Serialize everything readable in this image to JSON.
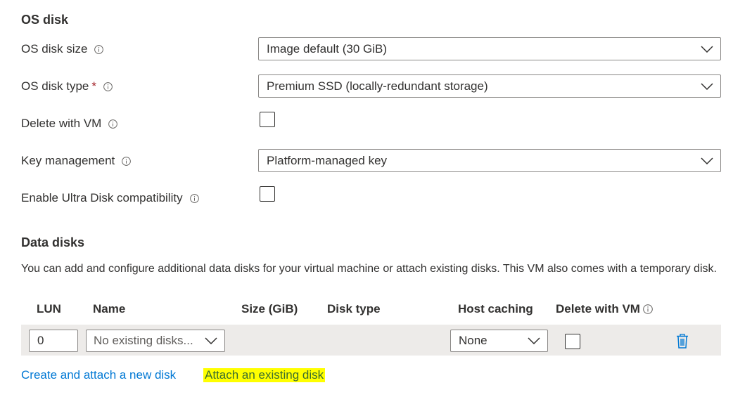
{
  "os_disk": {
    "title": "OS disk",
    "size_label": "OS disk size",
    "size_value": "Image default (30 GiB)",
    "type_label": "OS disk type",
    "type_required": "*",
    "type_value": "Premium SSD (locally-redundant storage)",
    "delete_label": "Delete with VM",
    "key_label": "Key management",
    "key_value": "Platform-managed key",
    "ultra_label": "Enable Ultra Disk compatibility"
  },
  "data_disks": {
    "title": "Data disks",
    "description": "You can add and configure additional data disks for your virtual machine or attach existing disks. This VM also comes with a temporary disk.",
    "columns": {
      "lun": "LUN",
      "name": "Name",
      "size": "Size (GiB)",
      "type": "Disk type",
      "caching": "Host caching",
      "delete": "Delete with VM"
    },
    "row": {
      "lun": "0",
      "name": "No existing disks...",
      "caching": "None"
    },
    "links": {
      "create": "Create and attach a new disk",
      "attach": "Attach an existing disk"
    }
  },
  "colors": {
    "link": "#0078d4",
    "highlight": "#ffff00",
    "row_bg": "#edebe9",
    "required": "#a4262c"
  }
}
